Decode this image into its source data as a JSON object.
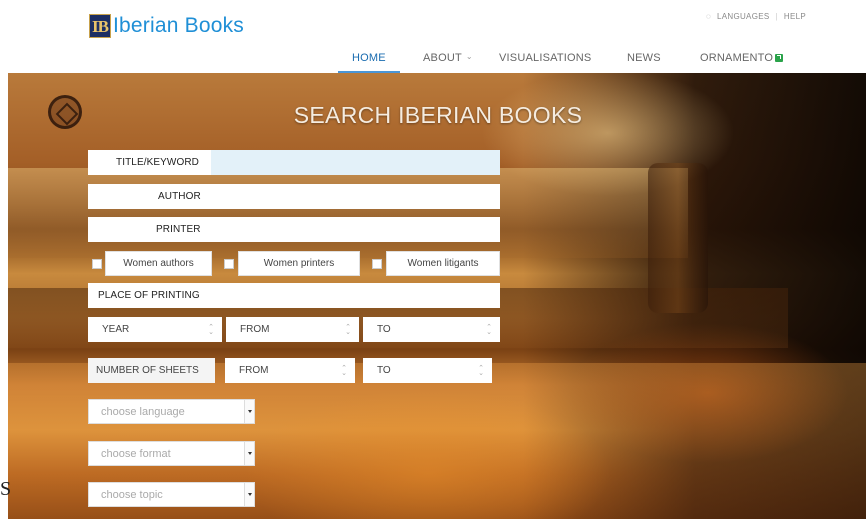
{
  "brand": {
    "logo_mark": "IB",
    "name": "Iberian Books"
  },
  "util_nav": {
    "languages": "LANGUAGES",
    "separator": "|",
    "help": "HELP"
  },
  "nav": {
    "home": "HOME",
    "about": "ABOUT",
    "visualisations": "VISUALISATIONS",
    "news": "NEWS",
    "ornamento": "ORNAMENTO"
  },
  "hero": {
    "title": "SEARCH IBERIAN BOOKS"
  },
  "form": {
    "title_keyword": "TITLE/KEYWORD",
    "author": "AUTHOR",
    "printer": "PRINTER",
    "checkboxes": [
      "Women authors",
      "Women printers",
      "Women litigants"
    ],
    "place_of_printing": "PLACE OF PRINTING",
    "year": {
      "label": "YEAR",
      "from": "FROM",
      "to": "TO"
    },
    "sheets": {
      "label": "NUMBER OF SHEETS",
      "from": "FROM",
      "to": "TO"
    },
    "language_placeholder": "choose language",
    "format_placeholder": "choose format",
    "topic_placeholder": "choose topic"
  },
  "stray_char": "S",
  "colors": {
    "brand_blue": "#1f8fd6",
    "nav_active": "#1a6cb0",
    "title_field_bg": "#e3f1f9"
  }
}
